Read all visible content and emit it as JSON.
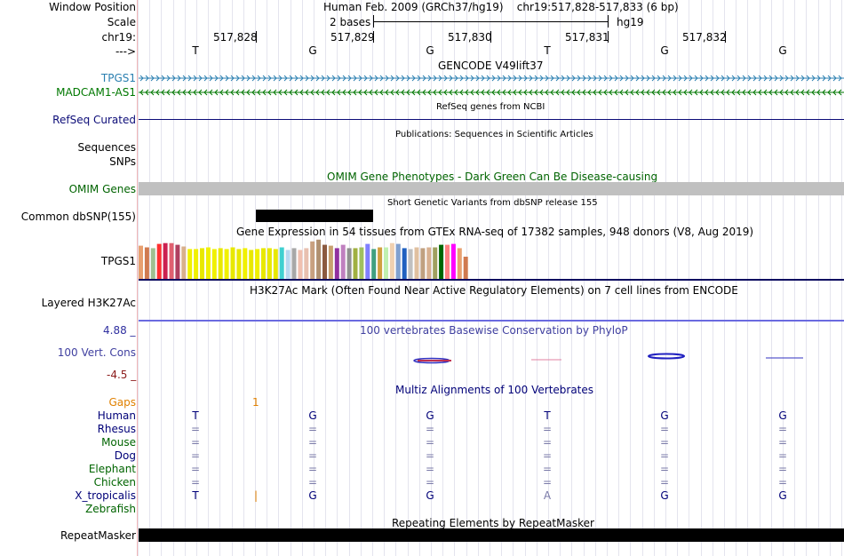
{
  "header": {
    "window_position_label": "Window Position",
    "window_position_value": "Human Feb. 2009 (GRCh37/hg19)    chr19:517,828-517,833 (6 bp)",
    "scale_label": "Scale",
    "scale_value": "2 bases",
    "scale_db": "hg19",
    "chrom_label": "chr19:",
    "positions": [
      "517,828",
      "517,829",
      "517,830",
      "517,831",
      "517,832"
    ],
    "strand_label": "--->",
    "bases": [
      "T",
      "G",
      "G",
      "T",
      "G",
      "G"
    ]
  },
  "tracks": {
    "gencode_title": "GENCODE V49lift37",
    "tpgs1": "TPGS1",
    "madcam1": "MADCAM1-AS1",
    "refseq_title": "RefSeq genes from NCBI",
    "refseq": "RefSeq Curated",
    "publications_title": "Publications: Sequences in Scientific Articles",
    "sequences": "Sequences",
    "snps": "SNPs",
    "omim_title": "OMIM Gene Phenotypes - Dark Green Can Be Disease-causing",
    "omim": "OMIM Genes",
    "dbsnp_title": "Short Genetic Variants from dbSNP release 155",
    "dbsnp": "Common dbSNP(155)",
    "gtex_title": "Gene Expression in 54 tissues from GTEx RNA-seq of 17382 samples, 948 donors (V8, Aug 2019)",
    "gtex": "TPGS1",
    "h3k27_title": "H3K27Ac Mark (Often Found Near Active Regulatory Elements) on 7 cell lines from ENCODE",
    "h3k27": "Layered H3K27Ac",
    "phylop_title": "100 vertebrates Basewise Conservation by PhyloP",
    "phylop_max": "4.88 _",
    "phylop_label": "100 Vert. Cons",
    "phylop_min": "-4.5 _",
    "multiz_title": "Multiz Alignments of 100 Vertebrates",
    "gaps": "Gaps",
    "gap_mark": "1",
    "repeat_title": "Repeating Elements by RepeatMasker",
    "repeat": "RepeatMasker"
  },
  "species": [
    {
      "name": "Human",
      "row": [
        "T",
        "G",
        "G",
        "T",
        "G",
        "G"
      ]
    },
    {
      "name": "Rhesus",
      "row": [
        "=",
        "=",
        "=",
        "=",
        "=",
        "="
      ]
    },
    {
      "name": "Mouse",
      "row": [
        "=",
        "=",
        "=",
        "=",
        "=",
        "="
      ]
    },
    {
      "name": "Dog",
      "row": [
        "=",
        "=",
        "=",
        "=",
        "=",
        "="
      ]
    },
    {
      "name": "Elephant",
      "row": [
        "=",
        "=",
        "=",
        "=",
        "=",
        "="
      ]
    },
    {
      "name": "Chicken",
      "row": [
        "=",
        "=",
        "=",
        "=",
        "=",
        "="
      ]
    },
    {
      "name": "X_tropicalis",
      "row": [
        "T",
        "|",
        "G",
        "G",
        "A",
        "G",
        "G"
      ]
    },
    {
      "name": "Zebrafish",
      "row": []
    }
  ],
  "colors": {
    "tpgs1": "#2a7fb0",
    "madcam1": "#007800",
    "refseq": "#0c0c78",
    "omim": "#006400",
    "phylop": "#4040a0",
    "phylop_max": "#3030a0",
    "phylop_min": "#8b1a1a",
    "gaps": "#e08000",
    "species_a": "#000078",
    "species_b": "#006400"
  },
  "gtex_levels": [
    0.78,
    0.74,
    0.72,
    0.82,
    0.84,
    0.84,
    0.8,
    0.76,
    0.7,
    0.7,
    0.72,
    0.74,
    0.7,
    0.72,
    0.7,
    0.74,
    0.7,
    0.72,
    0.68,
    0.7,
    0.72,
    0.72,
    0.7,
    0.74,
    0.68,
    0.72,
    0.68,
    0.72,
    0.88,
    0.92,
    0.8,
    0.78,
    0.72,
    0.8,
    0.72,
    0.72,
    0.74,
    0.82,
    0.7,
    0.74,
    0.74,
    0.84,
    0.82,
    0.72,
    0.7,
    0.74,
    0.72,
    0.74,
    0.74,
    0.8,
    0.8,
    0.82,
    0.72,
    0.52
  ],
  "gtex_colors": [
    "#e8a070",
    "#d07a50",
    "#a0c090",
    "#ff3030",
    "#cc2050",
    "#e06070",
    "#b04060",
    "#d8b08c",
    "#f0f000",
    "#f0f000",
    "#e8e800",
    "#f0f000",
    "#f0f000",
    "#e8e800",
    "#f0f000",
    "#e8e800",
    "#e8e800",
    "#f0f000",
    "#e8e800",
    "#f0f000",
    "#e8e800",
    "#e8e800",
    "#e8e800",
    "#40d0d0",
    "#b8d8f0",
    "#a8a8a8",
    "#f0c0b0",
    "#e8c0b0",
    "#c8a080",
    "#b09070",
    "#8b5a40",
    "#c8a070",
    "#9030a0",
    "#c080c0",
    "#909090",
    "#a0b040",
    "#a0c060",
    "#8080ff",
    "#40a080",
    "#d0a040",
    "#c0f0b0",
    "#f0d0b0",
    "#80a0d0",
    "#2060c0",
    "#c0c0c0",
    "#e0c0a0",
    "#c0a080",
    "#d8b090",
    "#a0a060",
    "#006600",
    "#ff8080",
    "#ff00ff"
  ]
}
